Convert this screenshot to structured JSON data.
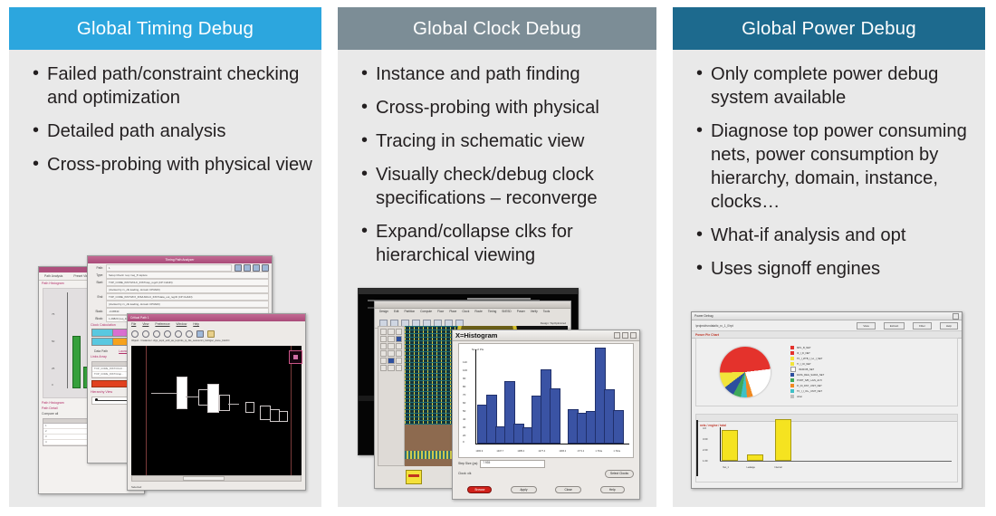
{
  "meta": {
    "colors": {
      "panel_bg": "#e9e9e9",
      "header_blue": "#2ca6de",
      "header_gray": "#7c8d96",
      "header_teal": "#1d6a8e",
      "text": "#231f20",
      "bar_blue": "#3a53a4",
      "bar_green": "#36a03b",
      "bar_yellow": "#f5e320",
      "accent_red": "#d0211a"
    }
  },
  "panels": [
    {
      "id": "timing",
      "title": "Global Timing Debug",
      "bullets": [
        "Failed path/constraint checking and optimization",
        "Detailed path analysis",
        "Cross-probing with physical view"
      ]
    },
    {
      "id": "clock",
      "title": "Global Clock Debug",
      "bullets": [
        "Instance and path finding",
        "Cross-probing with physical",
        "Tracing in schematic view",
        "Visually check/debug clock specifications – reconverge",
        "Expand/collapse clks for hierarchical viewing"
      ]
    },
    {
      "id": "power",
      "title": "Global Power Debug",
      "bullets": [
        "Only complete power debug system available",
        "Diagnose top power consuming nets, power consumption by hierarchy, domain, instance, clocks…",
        "What-if analysis and opt",
        "Uses signoff engines"
      ]
    }
  ],
  "timing_shot": {
    "left_window": {
      "section_title": "Path Histogram",
      "fields": [
        "Path Analysis",
        "Preset Views"
      ],
      "footer_title": "Path Histogram",
      "footer_section": "Path Detail",
      "footer_label": "Compare all",
      "table_rows": [
        "1",
        "2",
        "3",
        "4"
      ]
    },
    "analyzer_window": {
      "title": "Timing Path Analyzer",
      "path_label": "Path:",
      "path_value": "1",
      "rows": [
        {
          "k": "Type:",
          "v": "Setup Check: req->req_ff capture"
        },
        {
          "k": "Start:",
          "v": "TOP_CORE_INST/I/CLK_INST/cap_reg/A  (CP CHAIN)"
        },
        {
          "k": "",
          "v": "(clocked by rx_clk leading, domain CP3A00)"
        },
        {
          "k": "End:",
          "v": "TOP_CORE_INST/I/FX_INS/LMCLK_INST/data_out_reg/D  (CP CHAIN)"
        },
        {
          "k": "",
          "v": "(clocked by rx_clk leading, domain CP3A00)"
        },
        {
          "k": "Slack:",
          "v": "-0.08530"
        },
        {
          "k": "Block:",
          "v": "1.29820 (req_line.0)"
        }
      ],
      "clock_calc_label": "Clock Calculation",
      "tabs": [
        "Data Path",
        "Launch Clock"
      ],
      "table_title": "Links Array",
      "table_header": "Name",
      "table_rows": [
        "TOP_CORE_INST/I/CLK...",
        "TOP_CORE_INST/I/cap..."
      ],
      "hier_label": "Hierarchy View"
    },
    "schematic_window": {
      "title": "Critical Path 1",
      "menus": [
        "File",
        "View",
        "Preference",
        "Window",
        "Help"
      ],
      "object_label": "Object: <instance> cfgx_top1_ed3_as_top/mls_ip_bls_session/1_bs0/gsc_done_bls/I/O",
      "status": "Selected"
    }
  },
  "clock_shot": {
    "layout_window": {
      "menus": [
        "Design",
        "Edit",
        "Partition",
        "Compute",
        "Floor",
        "Place",
        "Clock",
        "Route",
        "Timing",
        "SI/ESD",
        "Power",
        "Verify",
        "Tools"
      ],
      "mode_label": "Design: TopOptimized"
    },
    "histogram_window": {
      "title": "X=Histogram",
      "ylabel": "No. of Pts",
      "step_label": "Step Size (ps):",
      "step_value": "7.935",
      "clock_label": "Clock: clk",
      "select_clocks_button": "Select Clocks",
      "buttons": [
        "Browse",
        "Apply",
        "Close",
        "Help"
      ]
    }
  },
  "power_shot": {
    "window_title": "Power Debug",
    "path_value": "/project/rundata/tc_rc_1_0/rpt",
    "toolbar_buttons": [
      "View",
      "Extract",
      "Filter",
      "Help"
    ],
    "pie_section_title": "Power Pie Chart",
    "bar_section_title": "nets / engine / total",
    "legend": [
      {
        "label": "MPL_B_NET",
        "color": "#e4322c"
      },
      {
        "label": "IF_I_D_NET",
        "color": "#e4322c"
      },
      {
        "label": "TF_I_I/ITB_I_I+I_I_NET",
        "color": "#f2e43a"
      },
      {
        "label": "TI_I_IO_NET",
        "color": "#f2e43a"
      },
      {
        "label": "ISCR/I/B_NET",
        "color": "#ffffff"
      },
      {
        "label": "DATA_REG_SAR/A_NET",
        "color": "#2d4f9e"
      },
      {
        "label": "PORT_S/B_I+GN_ALTI",
        "color": "#3fa85a"
      },
      {
        "label": "FI_IN_DST_UNIT_NET",
        "color": "#f08a22"
      },
      {
        "label": "TF_I_I_IO+_UNIT_NET",
        "color": "#3fc0c6"
      },
      {
        "label": "other",
        "color": "#bdbdbd"
      }
    ]
  },
  "chart_data": [
    {
      "type": "bar",
      "name": "timing-path-histogram",
      "title": "Path Histogram",
      "categories": [
        "b1",
        "b2",
        "b3",
        "b4",
        "b5"
      ],
      "values": [
        52,
        18,
        24,
        26,
        22
      ],
      "ylim": [
        0,
        100
      ],
      "color": "#36a03b",
      "xlabel": "",
      "ylabel": "",
      "tick_labels": [
        "",
        "",
        "",
        ""
      ]
    },
    {
      "type": "bar",
      "name": "clock-histogram",
      "title": "X=Histogram",
      "ylabel": "No. of Pts",
      "xlabel": "",
      "ylim": [
        0,
        120
      ],
      "ytick_labels": [
        "0",
        "10",
        "20",
        "30",
        "40",
        "50",
        "60",
        "70",
        "80",
        "90",
        "100",
        "110"
      ],
      "xtick_labels": [
        "1482.9",
        "1497.7",
        "1485.4",
        "1477.4",
        "1483.2",
        "1771.2",
        "1.734e",
        "1.742e",
        "1.738e"
      ],
      "categories": [
        "1",
        "2",
        "3",
        "4",
        "5",
        "6",
        "7",
        "8",
        "9",
        "10",
        "11",
        "12",
        "13",
        "14",
        "15",
        "16",
        "17"
      ],
      "values": [
        44,
        56,
        18,
        72,
        21,
        17,
        55,
        86,
        63,
        0,
        39,
        34,
        36,
        112,
        62,
        38,
        0
      ],
      "color": "#3a53a4"
    },
    {
      "type": "pie",
      "name": "power-pie-chart",
      "title": "Power Pie Chart",
      "labels": [
        "MPL_B_NET",
        "IF_I_D_NET",
        "TF_I_I/ITB_I_I+I_I_NET",
        "TI_I_IO_NET",
        "ISCR/I/B_NET",
        "DATA_REG_SAR/A_NET",
        "PORT_S/B_I+GN_ALTI",
        "FI_IN_DST_UNIT_NET",
        "TF_I_I_IO+_UNIT_NET",
        "other"
      ],
      "values": [
        23,
        13,
        10,
        8,
        22,
        7,
        5,
        4,
        4,
        4
      ],
      "colors": [
        "#e4322c",
        "#e4322c",
        "#f2e43a",
        "#f2e43a",
        "#ffffff",
        "#2d4f9e",
        "#3fa85a",
        "#f08a22",
        "#3fc0c6",
        "#bdbdbd"
      ]
    },
    {
      "type": "bar",
      "name": "power-bar-chart",
      "title": "nets / engine / total",
      "categories": [
        "Net_1",
        "Leakage",
        "Internal"
      ],
      "values": [
        2.6,
        0.35,
        3.3
      ],
      "ytick_labels": [
        "4.0",
        "3.00",
        "2.00",
        "1.00"
      ],
      "ylim": [
        0,
        4
      ],
      "color": "#f5e320"
    }
  ]
}
